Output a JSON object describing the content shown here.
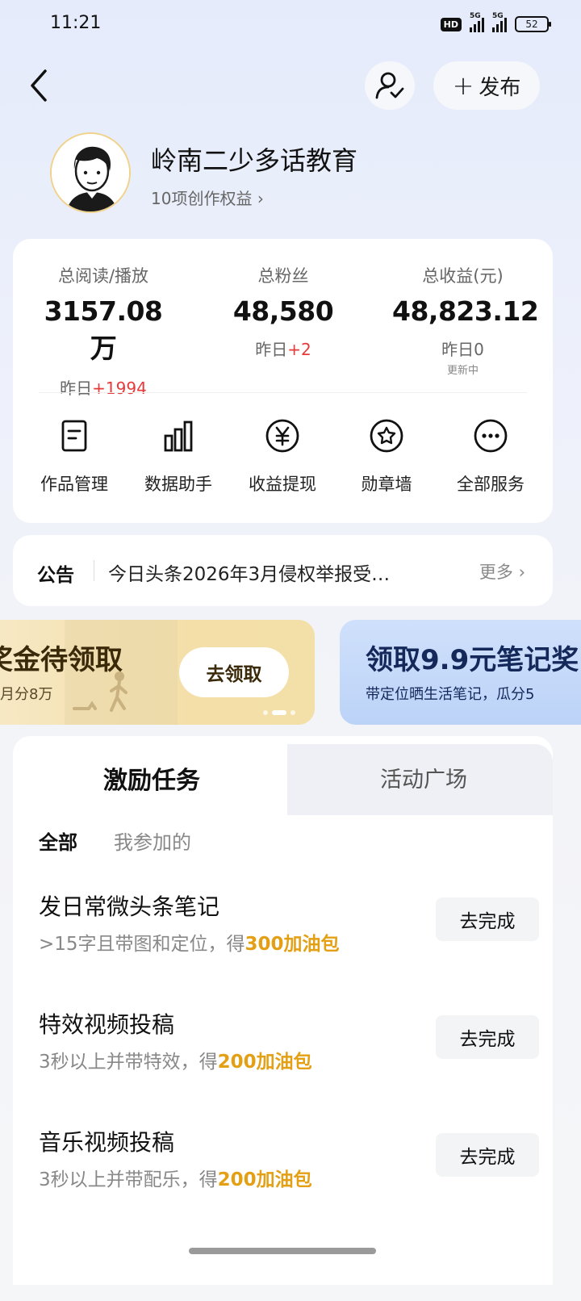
{
  "status_bar": {
    "time": "11:21",
    "hd": "HD",
    "net1": "5G",
    "net2": "5G",
    "battery": "52"
  },
  "header": {
    "publish_label": "发布"
  },
  "profile": {
    "name": "岭南二少多话教育",
    "rights": "10项创作权益"
  },
  "stats": [
    {
      "label": "总阅读/播放",
      "value": "3157.08万",
      "yesterday_prefix": "昨日",
      "yesterday_delta": "+1994"
    },
    {
      "label": "总粉丝",
      "value": "48,580",
      "yesterday_prefix": "昨日",
      "yesterday_delta": "+2"
    },
    {
      "label": "总收益(元)",
      "value": "48,823.12",
      "yesterday_prefix": "昨日0",
      "updating": "更新中"
    }
  ],
  "services": [
    {
      "label": "作品管理",
      "icon": "document-icon"
    },
    {
      "label": "数据助手",
      "icon": "bar-chart-icon"
    },
    {
      "label": "收益提现",
      "icon": "yen-icon"
    },
    {
      "label": "勋章墙",
      "icon": "medal-icon"
    },
    {
      "label": "全部服务",
      "icon": "more-icon"
    }
  ],
  "notice": {
    "tag": "公告",
    "text": "今日头条2026年3月侵权举报受…",
    "more": "更多"
  },
  "banners": {
    "left": {
      "title": "奖金待领取",
      "subtitle": "月分8万",
      "cta": "去领取"
    },
    "right": {
      "title": "领取9.9元笔记奖",
      "subtitle": "带定位晒生活笔记，瓜分5"
    }
  },
  "tabs": {
    "active": "激励任务",
    "inactive": "活动广场"
  },
  "subtabs": {
    "all": "全部",
    "joined": "我参加的"
  },
  "tasks": [
    {
      "title": "发日常微头条笔记",
      "desc": ">15字且带图和定位，得",
      "reward": "300加油包",
      "button": "去完成"
    },
    {
      "title": "特效视频投稿",
      "desc": "3秒以上并带特效，得",
      "reward": "200加油包",
      "button": "去完成"
    },
    {
      "title": "音乐视频投稿",
      "desc": "3秒以上并带配乐，得",
      "reward": "200加油包",
      "button": "去完成"
    }
  ],
  "colors": {
    "accent_red": "#e63a3a",
    "reward_orange": "#e3a014",
    "gold_banner": "#f4dfa9",
    "blue_banner": "#bcd3f8"
  }
}
